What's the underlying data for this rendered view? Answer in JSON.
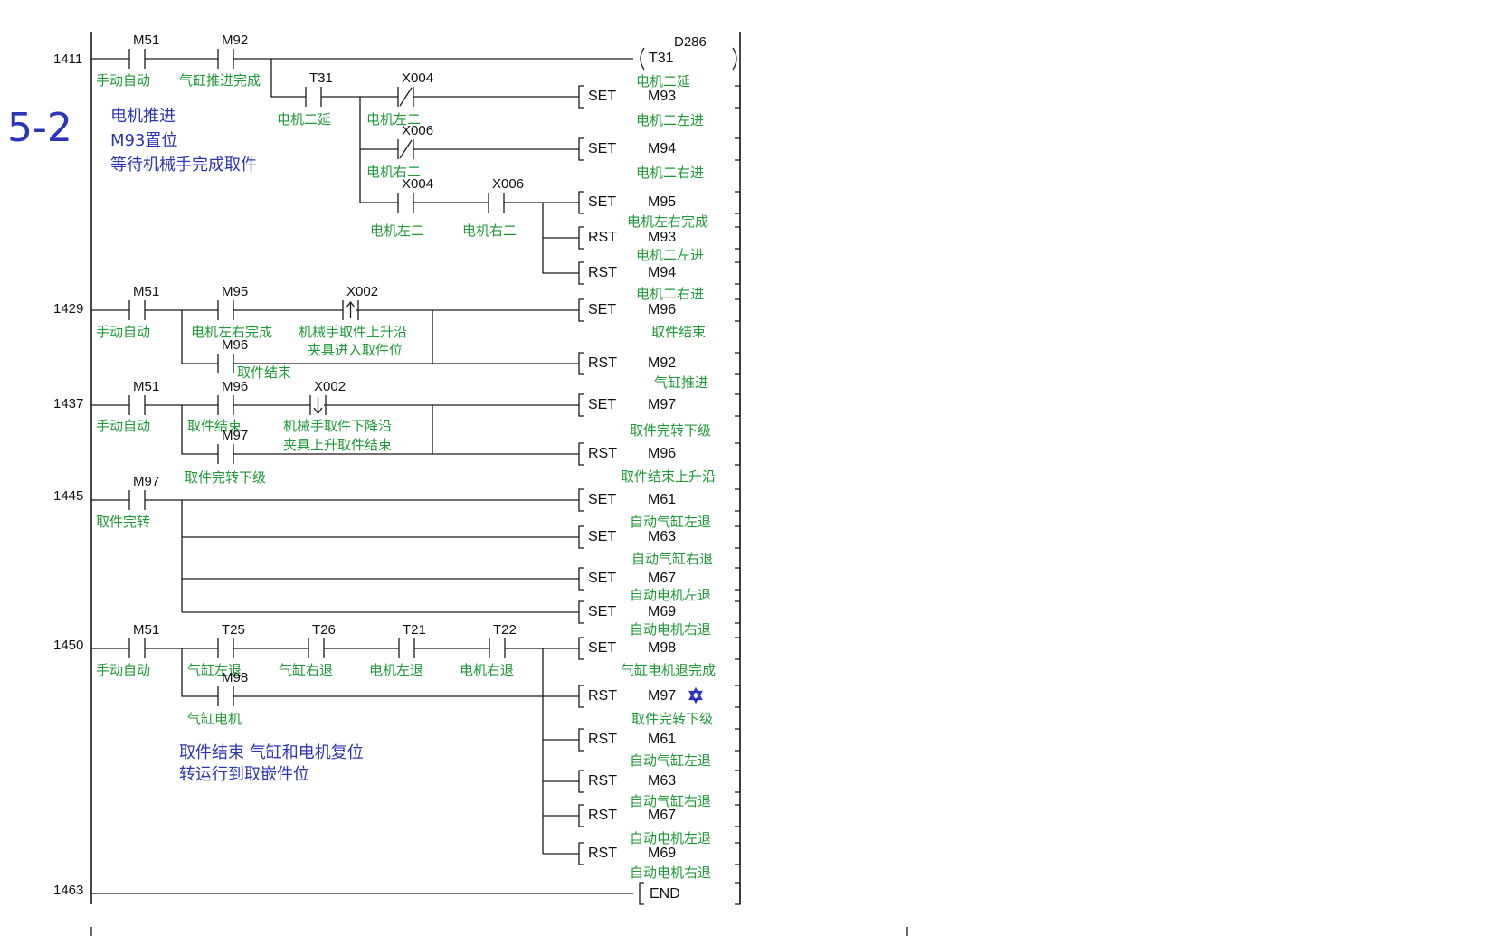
{
  "title": "5-2",
  "colors": {
    "wire": "#1a1a1a",
    "comment": "#1f9a36",
    "note": "#2c35b8"
  },
  "notes": [
    "电机推进",
    "M93置位",
    "等待机械手完成取件",
    "取件结束 气缸和电机复位",
    "转运行到取嵌件位"
  ],
  "steps": [
    "1411",
    "1429",
    "1437",
    "1445",
    "1450",
    "1463"
  ],
  "contacts": [
    {
      "dev": "M51",
      "cmt": "手动自动"
    },
    {
      "dev": "M92",
      "cmt": "气缸推进完成"
    },
    {
      "dev": "T31",
      "cmt": "电机二延"
    },
    {
      "dev": "X004",
      "cmt": "电机左二"
    },
    {
      "dev": "X006",
      "cmt": "电机右二"
    },
    {
      "dev": "X004",
      "cmt": "电机左二"
    },
    {
      "dev": "X006",
      "cmt": "电机右二"
    },
    {
      "dev": "M51",
      "cmt": "手动自动"
    },
    {
      "dev": "M95",
      "cmt": "电机左右完成"
    },
    {
      "dev": "X002",
      "cmt": "机械手取件上升沿"
    },
    {
      "dev": "M96",
      "cmt": "取件结束"
    },
    {
      "dev": "M51",
      "cmt": "手动自动"
    },
    {
      "dev": "M96",
      "cmt": "取件结束"
    },
    {
      "dev": "X002",
      "cmt": "机械手取件下降沿"
    },
    {
      "dev": "M97",
      "cmt": "取件完转下级"
    },
    {
      "dev": "M97",
      "cmt": "取件完转"
    },
    {
      "dev": "M51",
      "cmt": "手动自动"
    },
    {
      "dev": "T25",
      "cmt": "气缸左退"
    },
    {
      "dev": "T26",
      "cmt": "气缸右退"
    },
    {
      "dev": "T21",
      "cmt": "电机左退"
    },
    {
      "dev": "T22",
      "cmt": "电机右退"
    },
    {
      "dev": "M98",
      "cmt": "气缸电机"
    }
  ],
  "extra_comments": [
    "夹具进入取件位",
    "夹具上升取件结束"
  ],
  "coils": [
    {
      "ins": "T31",
      "dev": "D286",
      "cmt": "电机二延"
    },
    {
      "ins": "SET",
      "dev": "M93",
      "cmt": "电机二左进"
    },
    {
      "ins": "SET",
      "dev": "M94",
      "cmt": "电机二右进"
    },
    {
      "ins": "SET",
      "dev": "M95",
      "cmt": "电机左右完成"
    },
    {
      "ins": "RST",
      "dev": "M93",
      "cmt": "电机二左进"
    },
    {
      "ins": "RST",
      "dev": "M94",
      "cmt": "电机二右进"
    },
    {
      "ins": "SET",
      "dev": "M96",
      "cmt": "取件结束"
    },
    {
      "ins": "RST",
      "dev": "M92",
      "cmt": "气缸推进"
    },
    {
      "ins": "SET",
      "dev": "M97",
      "cmt": "取件完转下级"
    },
    {
      "ins": "RST",
      "dev": "M96",
      "cmt": "取件结束上升沿"
    },
    {
      "ins": "SET",
      "dev": "M61",
      "cmt": "自动气缸左退"
    },
    {
      "ins": "SET",
      "dev": "M63",
      "cmt": "自动气缸右退"
    },
    {
      "ins": "SET",
      "dev": "M67",
      "cmt": "自动电机左退"
    },
    {
      "ins": "SET",
      "dev": "M69",
      "cmt": "自动电机右退"
    },
    {
      "ins": "SET",
      "dev": "M98",
      "cmt": "气缸电机退完成"
    },
    {
      "ins": "RST",
      "dev": "M97",
      "cmt": "取件完转下级"
    },
    {
      "ins": "RST",
      "dev": "M61",
      "cmt": "自动气缸左退"
    },
    {
      "ins": "RST",
      "dev": "M63",
      "cmt": "自动气缸右退"
    },
    {
      "ins": "RST",
      "dev": "M67",
      "cmt": "自动电机左退"
    },
    {
      "ins": "RST",
      "dev": "M69",
      "cmt": "自动电机右退"
    },
    {
      "ins": "END",
      "dev": "",
      "cmt": ""
    }
  ]
}
